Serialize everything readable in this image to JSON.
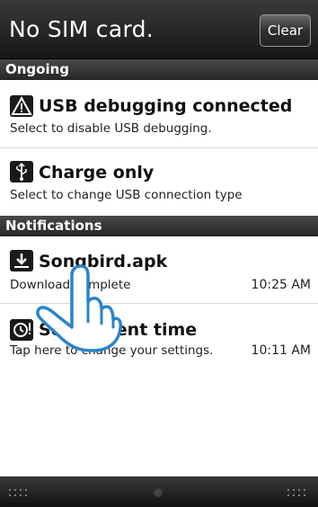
{
  "header": {
    "title": "No SIM card.",
    "clear_label": "Clear"
  },
  "sections": {
    "ongoing": "Ongoing",
    "notifications": "Notifications"
  },
  "ongoing": [
    {
      "title": "USB debugging connected",
      "subtitle": "Select to disable USB debugging.",
      "icon": "warning-icon"
    },
    {
      "title": "Charge only",
      "subtitle": "Select to change USB connection type",
      "icon": "usb-icon"
    }
  ],
  "notifications": [
    {
      "title": "Songbird.apk",
      "subtitle": "Download complete",
      "time": "10:25 AM",
      "icon": "download-icon"
    },
    {
      "title": "Set current time",
      "subtitle": "Tap here to change your settings.",
      "time": "10:11 AM",
      "icon": "clock-settings-icon"
    }
  ],
  "colors": {
    "header_bg": "#1e1e1e",
    "section_bg": "#333333",
    "text": "#111111",
    "hand_outline": "#2a84c8"
  }
}
